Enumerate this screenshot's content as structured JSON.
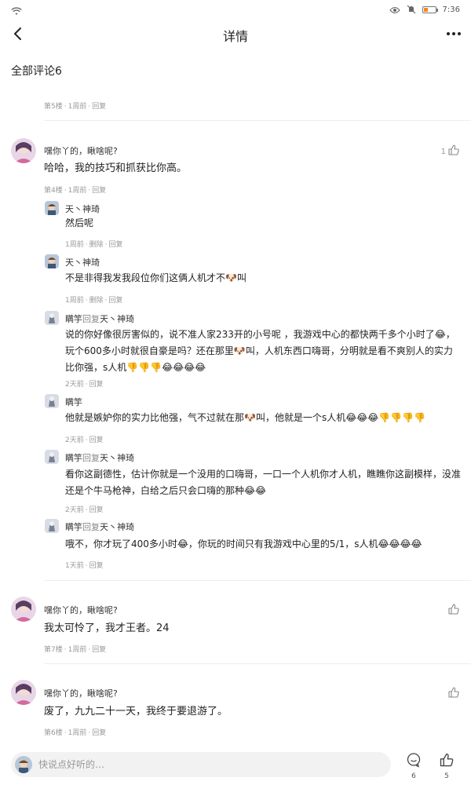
{
  "status": {
    "time": "7:36"
  },
  "header": {
    "title": "详情"
  },
  "comments_header": "全部评论6",
  "fragment_meta": {
    "floor": "第5楼",
    "time": "1周前",
    "reply": "回复"
  },
  "comments": [
    {
      "name": "嘿你丫的，瞅啥呢?",
      "text": "哈哈，我的技巧和抓获比你高。",
      "floor": "第4楼",
      "time": "1周前",
      "reply": "回复",
      "likes": "1",
      "replies": [
        {
          "name": "天丶神琦",
          "text": "然后呢",
          "time": "1周前",
          "delete": "删除",
          "reply": "回复"
        },
        {
          "name": "天丶神琦",
          "text": "不是非得我发我段位你们这俩人机才不🐶叫",
          "time": "1周前",
          "delete": "删除",
          "reply": "回复"
        },
        {
          "name": "瞒竽",
          "reply_word": "回复",
          "target": "天丶神琦",
          "text": "说的你好像很厉害似的，说不准人家233开的小号呢 ，我游戏中心的都快两千多个小时了😂，玩个600多小时就很自豪是吗？还在那里🐶叫，人机东西口嗨哥，分明就是看不爽别人的实力比你强，s人机👎👎👎😂😂😂😂",
          "time": "2天前",
          "reply": "回复"
        },
        {
          "name": "瞒竽",
          "text": "他就是嫉妒你的实力比他强，气不过就在那🐶叫，他就是一个s人机😂😂😂👎👎👎👎",
          "time": "2天前",
          "reply": "回复"
        },
        {
          "name": "瞒竽",
          "reply_word": "回复",
          "target": "天丶神琦",
          "text": "看你这副德性，估计你就是一个没用的口嗨哥，一口一个人机你才人机，瞧瞧你这副模样，没准还是个牛马枪神，白给之后只会口嗨的那种😂😂",
          "time": "2天前",
          "reply": "回复"
        },
        {
          "name": "瞒竽",
          "reply_word": "回复",
          "target": "天丶神琦",
          "text": "哦不，你才玩了400多小时😂，你玩的时间只有我游戏中心里的5/1，s人机😂😂😂😂",
          "time": "1天前",
          "reply": "回复"
        }
      ]
    },
    {
      "name": "嘿你丫的，瞅啥呢?",
      "text": "我太可怜了，我才王者。24",
      "floor": "第7楼",
      "time": "1周前",
      "reply": "回复"
    },
    {
      "name": "嘿你丫的，瞅啥呢?",
      "text": "废了，九九二十一天，我终于要退游了。",
      "floor": "第6楼",
      "time": "1周前",
      "reply": "回复"
    }
  ],
  "bottom": {
    "placeholder": "快说点好听的…",
    "comment_count": "6",
    "like_count": "5"
  },
  "icons": [
    "wifi-icon",
    "eye-icon",
    "mute-icon",
    "battery-icon",
    "back-arrow-icon",
    "more-icon",
    "thumbs-up-icon",
    "comment-bubble-icon",
    "avatar-icon"
  ],
  "colors": {
    "battery": "#f08a24",
    "meta": "#999999",
    "divider": "#eeeeee"
  }
}
